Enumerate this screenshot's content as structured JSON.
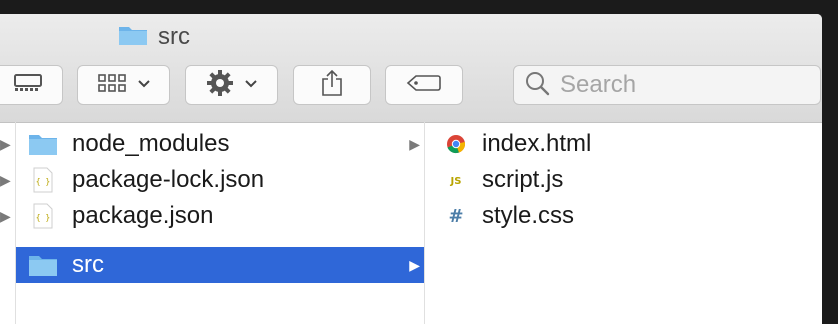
{
  "window": {
    "title": "src"
  },
  "toolbar": {
    "search": {
      "placeholder": "Search",
      "icon": "magnifier-icon"
    }
  },
  "column1": {
    "items": [
      {
        "label": "node_modules",
        "icon": "folder-icon",
        "has_children": true,
        "selected": false
      },
      {
        "label": "package-lock.json",
        "icon": "json-file-icon",
        "has_children": false,
        "selected": false
      },
      {
        "label": "package.json",
        "icon": "json-file-icon",
        "has_children": false,
        "selected": false
      },
      {
        "label": "src",
        "icon": "folder-icon",
        "has_children": true,
        "selected": true
      }
    ]
  },
  "column2": {
    "items": [
      {
        "label": "index.html",
        "icon": "chrome-html-file-icon"
      },
      {
        "label": "script.js",
        "icon": "js-file-icon"
      },
      {
        "label": "style.css",
        "icon": "css-file-icon"
      }
    ]
  },
  "colors": {
    "selection": "#2f67d8",
    "folder": "#7cc0ef",
    "toolbar": "#e4e4e4"
  }
}
